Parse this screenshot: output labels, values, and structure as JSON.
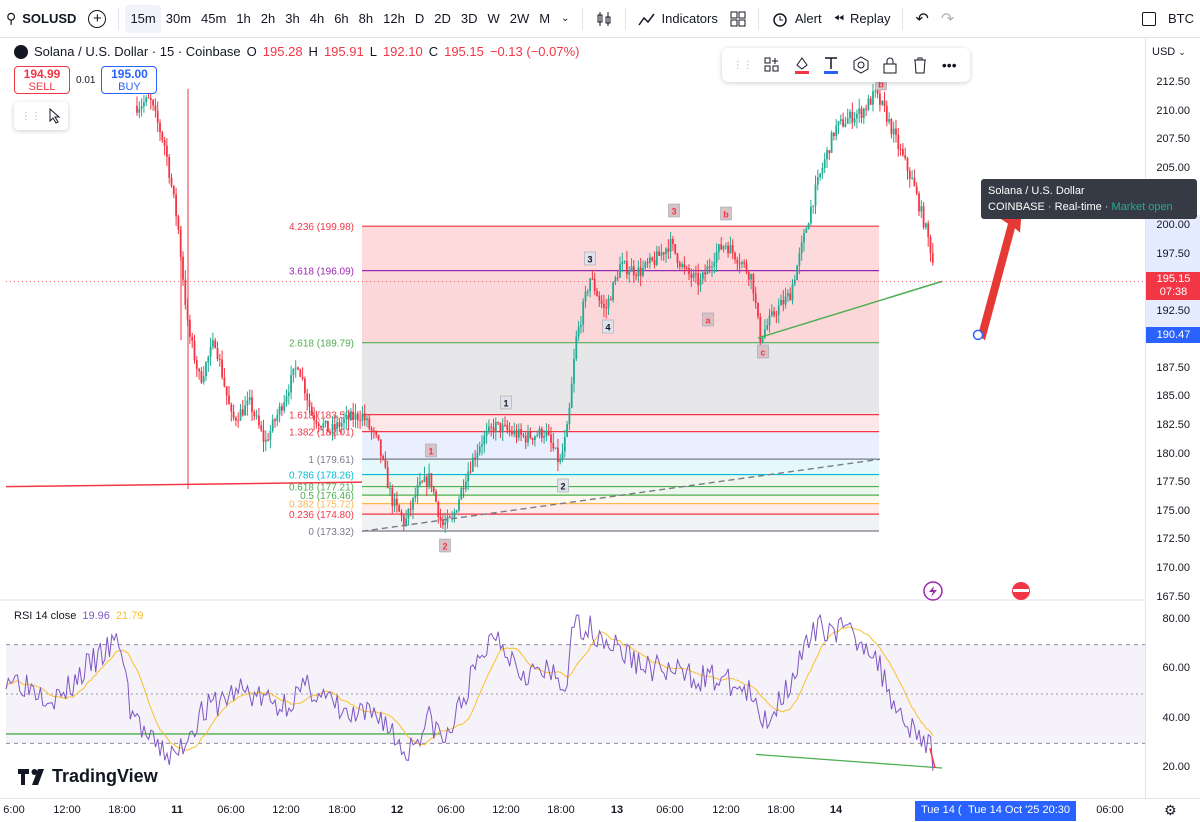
{
  "topbar": {
    "symbol": "SOLUSD",
    "timeframes": [
      "15m",
      "30m",
      "45m",
      "1h",
      "2h",
      "3h",
      "4h",
      "6h",
      "8h",
      "12h",
      "D",
      "2D",
      "3D",
      "W",
      "2W",
      "M"
    ],
    "active_timeframe": "15m",
    "indicators_label": "Indicators",
    "alert_label": "Alert",
    "replay_label": "Replay",
    "compare_label": "BTC"
  },
  "legend": {
    "title": "Solana / U.S. Dollar · 15 · Coinbase",
    "o_label": "O",
    "o": "195.28",
    "h_label": "H",
    "h": "195.91",
    "l_label": "L",
    "l": "192.10",
    "c_label": "C",
    "c": "195.15",
    "change": "−0.13 (−0.07%)"
  },
  "trade": {
    "sell_price": "194.99",
    "sell_label": "SELL",
    "spread": "0.01",
    "buy_price": "195.00",
    "buy_label": "BUY"
  },
  "price_axis": {
    "currency": "USD",
    "labels": [
      "212.50",
      "210.00",
      "207.50",
      "205.00",
      "200.00",
      "197.50",
      "192.50",
      "187.50",
      "185.00",
      "182.50",
      "180.00",
      "177.50",
      "175.00",
      "172.50",
      "170.00",
      "167.50"
    ],
    "current_price": "195.15",
    "countdown": "07:38",
    "crosshair_price": "190.47",
    "rsi_labels": [
      "80.00",
      "60.00",
      "40.00",
      "20.00"
    ]
  },
  "tooltip": {
    "title": "Solana / U.S. Dollar",
    "exchange": "COINBASE",
    "feed": "Real-time",
    "status": "Market open"
  },
  "fib": {
    "levels": [
      "4.236 (199.98)",
      "3.618 (196.09)",
      "2.618 (189.79)",
      "1.618 (183.50)",
      "1.382 (182.01)",
      "1 (179.61)",
      "0.786 (178.26)",
      "0.618 (177.21)",
      "0.5 (176.46)",
      "0.382 (175.72)",
      "0.236 (174.80)",
      "0 (173.32)"
    ],
    "colors": [
      "#f23645",
      "#9c27b0",
      "#4caf50",
      "#f23645",
      "#f23645",
      "#787b86",
      "#00bcd4",
      "#4caf50",
      "#4caf50",
      "#ffb74d",
      "#f23645",
      "#787b86"
    ]
  },
  "waves": {
    "labels": [
      "1",
      "2",
      "3",
      "4",
      "1",
      "2",
      "3",
      "a",
      "b",
      "c",
      "b"
    ]
  },
  "rsi": {
    "label": "RSI 14 close",
    "value1": "19.96",
    "value2": "21.79"
  },
  "time_axis": {
    "labels": [
      "6:00",
      "12:00",
      "18:00",
      "11",
      "06:00",
      "12:00",
      "18:00",
      "12",
      "06:00",
      "12:00",
      "18:00",
      "13",
      "06:00",
      "12:00",
      "18:00",
      "14",
      "06:00",
      "06:00"
    ],
    "highlight_short": "Tue 14 (",
    "highlight_full": "Tue 14 Oct '25   20:30"
  },
  "brand": {
    "name": "TradingView"
  },
  "colors": {
    "up": "#22ab94",
    "down": "#f23645",
    "accent": "#2962ff",
    "rsi": "#7e57c2",
    "rsi_ma": "#fbc02d"
  }
}
